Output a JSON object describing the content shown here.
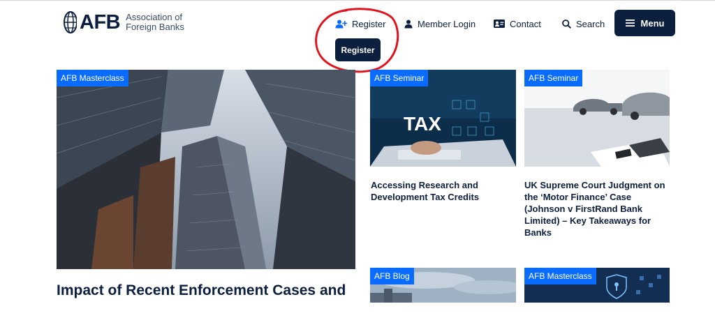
{
  "header": {
    "logo_abbr": "AFB",
    "logo_name": "Association of Foreign Banks",
    "nav": {
      "register": "Register",
      "member_login": "Member Login",
      "contact": "Contact",
      "search": "Search",
      "menu": "Menu"
    },
    "register_popup": "Register"
  },
  "cards": [
    {
      "badge": "AFB Masterclass",
      "title": "Impact of Recent Enforcement Cases and"
    },
    {
      "badge": "AFB Seminar",
      "title": "Accessing Research and Development Tax Credits",
      "image_text": "TAX"
    },
    {
      "badge": "AFB Seminar",
      "title": "UK Supreme Court Judgment on the ‘Motor Finance’ Case (Johnson v FirstRand Bank Limited) – Key Takeaways for Banks"
    },
    {
      "badge": "AFB Blog"
    },
    {
      "badge": "AFB Masterclass"
    }
  ],
  "colors": {
    "navy": "#0c1f3f",
    "badge_blue": "#0a6cff",
    "annotation_red": "#e0141e"
  },
  "icons": [
    "globe-logo-icon",
    "add-user-icon",
    "user-icon",
    "contact-card-icon",
    "search-icon",
    "hamburger-icon"
  ]
}
